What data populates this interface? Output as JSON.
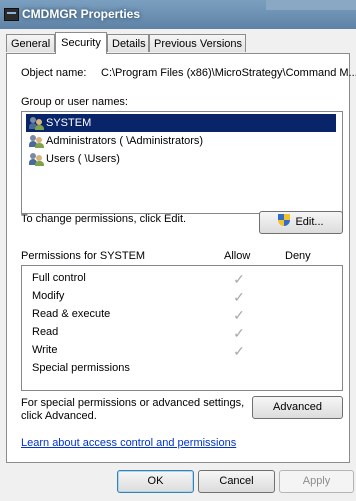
{
  "window": {
    "title": "CMDMGR Properties"
  },
  "tabs": [
    {
      "label": "General",
      "active": false
    },
    {
      "label": "Security",
      "active": true
    },
    {
      "label": "Details",
      "active": false
    },
    {
      "label": "Previous Versions",
      "active": false
    }
  ],
  "security": {
    "object_name_label": "Object name:",
    "object_name_value": "C:\\Program Files (x86)\\MicroStrategy\\Command M...",
    "group_label": "Group or user names:",
    "users": [
      {
        "name": "SYSTEM",
        "selected": true
      },
      {
        "name": "Administrators (                    \\Administrators)",
        "selected": false
      },
      {
        "name": "Users (                    \\Users)",
        "selected": false
      }
    ],
    "change_text": "To change permissions, click Edit.",
    "edit_button": "Edit...",
    "permissions_label": "Permissions for SYSTEM",
    "allow_header": "Allow",
    "deny_header": "Deny",
    "permissions": [
      {
        "name": "Full control",
        "allow": "✓",
        "deny": ""
      },
      {
        "name": "Modify",
        "allow": "✓",
        "deny": ""
      },
      {
        "name": "Read & execute",
        "allow": "✓",
        "deny": ""
      },
      {
        "name": "Read",
        "allow": "✓",
        "deny": ""
      },
      {
        "name": "Write",
        "allow": "✓",
        "deny": ""
      },
      {
        "name": "Special permissions",
        "allow": "",
        "deny": ""
      }
    ],
    "special_text_1": "For special permissions or advanced settings,",
    "special_text_2": "click Advanced.",
    "advanced_button": "Advanced",
    "learn_link": "Learn about access control and permissions"
  },
  "footer": {
    "ok": "OK",
    "cancel": "Cancel",
    "apply": "Apply"
  },
  "colors": {
    "selection": "#0a246a",
    "link": "#0033cc",
    "titlebar": "#6a8fb2"
  }
}
